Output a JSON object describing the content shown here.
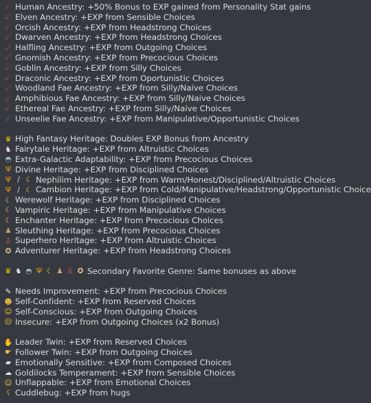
{
  "colors": {
    "background": "#36393f",
    "text": "#dcddde"
  },
  "groups": [
    {
      "id": "ancestry",
      "lines": [
        {
          "icons": [
            "comet-icon"
          ],
          "text": "Human Ancestry: +50% Bonus to EXP gained from Personality Stat gains"
        },
        {
          "icons": [
            "comet-icon"
          ],
          "text": "Elven Ancestry: +EXP from Sensible Choices"
        },
        {
          "icons": [
            "comet-icon"
          ],
          "text": "Orcish Ancestry: +EXP from Headstrong Choices"
        },
        {
          "icons": [
            "comet-icon"
          ],
          "text": "Dwarven Ancestry: +EXP from Headstrong Choices"
        },
        {
          "icons": [
            "comet-icon"
          ],
          "text": "Halfling Ancestry: +EXP from Outgoing Choices"
        },
        {
          "icons": [
            "comet-icon"
          ],
          "text": "Gnomish Ancestry: +EXP from Precocious Choices"
        },
        {
          "icons": [
            "comet-icon"
          ],
          "text": "Goblin Ancestry: +EXP from Silly Choices"
        },
        {
          "icons": [
            "comet-icon"
          ],
          "text": "Draconic Ancestry: +EXP from Oportunistic Choices"
        },
        {
          "icons": [
            "comet-icon"
          ],
          "text": "Woodland Fae Ancestry: +EXP from Silly/Naive Choices"
        },
        {
          "icons": [
            "comet-icon"
          ],
          "text": "Amphibious Fae Ancestry: +EXP from Silly/Naive Choices"
        },
        {
          "icons": [
            "comet-icon"
          ],
          "text": "Ethereal Fae Ancestry: +EXP from Silly/Naive Choices"
        },
        {
          "icons": [
            "comet-icon"
          ],
          "text": "Unseelie Fae Ancestry: +EXP from Manipulative/Opportunistic Choices"
        }
      ]
    },
    {
      "id": "heritage",
      "lines": [
        {
          "icons": [
            "crown-icon"
          ],
          "text": "High Fantasy Heritage: Doubles EXP Bonus from Ancestry"
        },
        {
          "icons": [
            "unicorn-icon"
          ],
          "text": "Fairytale Heritage: +EXP from Altruistic Choices"
        },
        {
          "icons": [
            "ufo-icon"
          ],
          "text": "Extra-Galactic Adaptability: +EXP from Precocious Choices"
        },
        {
          "icons": [
            "trident-icon"
          ],
          "text": "Divine Heritage: +EXP from Disciplined Choices"
        },
        {
          "icons": [
            "trident-icon",
            "slash-icon",
            "crescent-moon-icon"
          ],
          "text": "  Nephilim Heritage: +EXP from Warm/Honest/Disciplined/Altruistic Choices"
        },
        {
          "icons": [
            "trident-icon",
            "slash-icon",
            "crescent-moon-icon"
          ],
          "text": "Cambion Heritage: +EXP from Cold/Manipulative/Headstrong/Opportunistic Choices"
        },
        {
          "icons": [
            "crescent-moon-icon"
          ],
          "text": "Werewolf Heritage: +EXP from Disciplined Choices"
        },
        {
          "icons": [
            "crescent-moon-icon"
          ],
          "text": "Vampiric Heritage: +EXP from Manipulative Choices"
        },
        {
          "icons": [
            "crescent-moon-icon"
          ],
          "text": "Enchanter Heritage: +EXP from Precocious Choices"
        },
        {
          "icons": [
            "detective-icon"
          ],
          "text": "Sleuthing Heritage: +EXP from Precocious Choices"
        },
        {
          "icons": [
            "superhero-icon"
          ],
          "text": "Superhero Heritage: +EXP from Altruistic Choices"
        },
        {
          "icons": [
            "compass-icon"
          ],
          "text": "Adventurer Heritage: +EXP from Headstrong Choices"
        }
      ]
    },
    {
      "id": "secondary",
      "lines": [
        {
          "icons": [
            "crown-icon",
            "unicorn-icon",
            "ufo-icon",
            "trident-icon",
            "crescent-moon-icon",
            "detective-icon",
            "superhero-icon",
            "compass-icon"
          ],
          "text": "Secondary Favorite Genre: Same bonuses as above"
        }
      ]
    },
    {
      "id": "traits",
      "lines": [
        {
          "icons": [
            "memo-icon"
          ],
          "text": "Needs Improvement: +EXP from Precocious Choices"
        },
        {
          "icons": [
            "sunglasses-face-icon"
          ],
          "text": "Self-Confident: +EXP from Reserved Choices"
        },
        {
          "icons": [
            "sweat-smile-face-icon"
          ],
          "text": "Self-Conscious: +EXP from Outgoing Choices"
        },
        {
          "icons": [
            "worried-face-icon"
          ],
          "text": "Insecure: +EXP from Outgoing Choices (x2 Bonus)"
        }
      ]
    },
    {
      "id": "misc",
      "lines": [
        {
          "icons": [
            "waving-hand-icon"
          ],
          "text": "Leader Twin: +EXP from Reserved Choices"
        },
        {
          "icons": [
            "pointing-hand-icon"
          ],
          "text": "Follower Twin: +EXP from Outgoing Choices"
        },
        {
          "icons": [
            "speech-bubble-icon"
          ],
          "text": "Emotionally Sensitive: +EXP from Composed Choices"
        },
        {
          "icons": [
            "cloud-icon"
          ],
          "text": "Goldilocks Temperament: +EXP from Sensible Choices"
        },
        {
          "icons": [
            "relieved-face-icon"
          ],
          "text": "Unflappable: +EXP from Emotional Choices"
        },
        {
          "icons": [
            "bear-icon"
          ],
          "text": "Cuddlebug: +EXP from hugs"
        }
      ]
    }
  ]
}
